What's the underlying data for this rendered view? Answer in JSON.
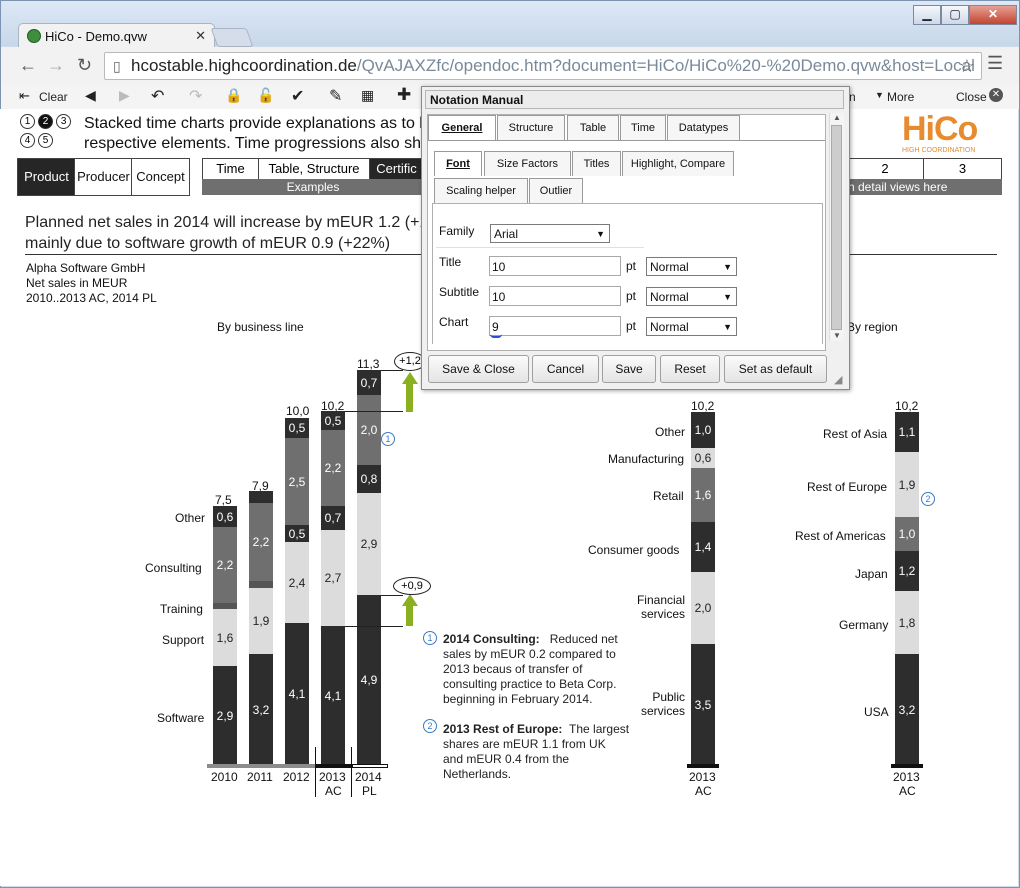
{
  "browser": {
    "tab_title": "HiCo - Demo.qvw",
    "url_host": "hcostable.highcoordination.de",
    "url_path": "/QvAJAXZfc/opendoc.htm?document=HiCo/HiCo%20-%20Demo.qvw&host=Local"
  },
  "qvtoolbar": {
    "clear": "Clear",
    "more": "More",
    "close": "Close",
    "partial_on": "n"
  },
  "header": {
    "step_circles": [
      "1",
      "2",
      "3",
      "4",
      "5"
    ],
    "line1": "Stacked time charts provide explanations as to ho",
    "line2": "respective elements. Time progressions also sho",
    "logo_text": "HiCo",
    "logo_sub": "HIGH COORDINATION"
  },
  "nav": {
    "product": "Product",
    "producer": "Producer",
    "concept": "Concept",
    "time": "Time",
    "table_structure": "Table, Structure",
    "certific": "Certific",
    "examples": "Examples",
    "right_nums": [
      "2",
      "3"
    ],
    "right_caption": "h detail views here"
  },
  "statement": {
    "line1": "Planned net sales in 2014 will increase by mEUR 1.2 (+12",
    "line2": "mainly due to software growth of mEUR 0.9 (+22%)"
  },
  "meta": {
    "company": "Alpha Software GmbH",
    "measure": "Net sales in MEUR",
    "period": "2010..2013 AC, 2014 PL"
  },
  "charts": {
    "by_business_line": "By business line",
    "by_region": "By region",
    "categories": [
      "Software",
      "Support",
      "Training",
      "Consulting",
      "Other"
    ],
    "years": [
      "2010",
      "2011",
      "2012",
      "2013",
      "2014"
    ],
    "year_sub": [
      "AC",
      "PL"
    ],
    "totals": [
      "7,5",
      "7,9",
      "10,0",
      "10,2",
      "11,3"
    ],
    "bars": [
      {
        "year": "2010",
        "software": "2,9",
        "support": "1,6",
        "consulting": "2,2",
        "other": "0,6"
      },
      {
        "year": "2011",
        "software": "3,2",
        "support": "1,9",
        "consulting": "2,2",
        "other": ""
      },
      {
        "year": "2012",
        "software": "4,1",
        "support": "2,4",
        "training": "0,5",
        "consulting": "2,5",
        "other": "0,5"
      },
      {
        "year": "2013",
        "software": "4,1",
        "support": "2,7",
        "training": "0,7",
        "consulting": "2,2",
        "other": "0,5"
      },
      {
        "year": "2014",
        "software": "4,9",
        "support": "2,9",
        "training": "0,8",
        "consulting": "2,0",
        "other": "0,7"
      }
    ],
    "delta_total": "+1,2",
    "delta_software": "+0,9",
    "industry": {
      "total": "10,2",
      "segments": [
        {
          "label": "Other",
          "value": "1,0"
        },
        {
          "label": "Manufacturing",
          "value": "0,6"
        },
        {
          "label": "Retail",
          "value": "1,6"
        },
        {
          "label": "Consumer goods",
          "value": "1,4"
        },
        {
          "label": "Financial services",
          "value": "2,0"
        },
        {
          "label": "Public services",
          "value": "3,5"
        }
      ],
      "x": "2013",
      "x_sub": "AC"
    },
    "region": {
      "total": "10,2",
      "segments": [
        {
          "label": "Rest of Asia",
          "value": "1,1"
        },
        {
          "label": "Rest of Europe",
          "value": "1,9"
        },
        {
          "label": "Rest of Americas",
          "value": "1,0"
        },
        {
          "label": "Japan",
          "value": "1,2"
        },
        {
          "label": "Germany",
          "value": "1,8"
        },
        {
          "label": "USA",
          "value": "3,2"
        }
      ],
      "x": "2013",
      "x_sub": "AC"
    }
  },
  "comments": [
    {
      "num": "1",
      "title": "2014 Consulting:",
      "lines": [
        "Reduced net",
        "sales by mEUR 0.2 compared to",
        "2013 becaus of transfer of",
        "consulting practice to Beta Corp.",
        "beginning in  February 2014."
      ]
    },
    {
      "num": "2",
      "title": "2013 Rest of Europe:",
      "lines": [
        "The largest",
        "shares are mEUR 1.1 from UK",
        "and mEUR 0.4 from the",
        "Netherlands."
      ]
    }
  ],
  "dialog": {
    "title": "Notation Manual",
    "tabs": [
      "General",
      "Structure",
      "Table",
      "Time",
      "Datatypes"
    ],
    "subtabs_row1": [
      "Font",
      "Size Factors",
      "Titles",
      "Highlight, Compare"
    ],
    "subtabs_row2": [
      "Scaling helper",
      "Outlier"
    ],
    "family_label": "Family",
    "family_value": "Arial",
    "rows": [
      {
        "label": "Title",
        "value": "10",
        "unit": "pt",
        "style": "Normal"
      },
      {
        "label": "Subtitle",
        "value": "10",
        "unit": "pt",
        "style": "Normal"
      },
      {
        "label": "Chart",
        "value": "9",
        "unit": "pt",
        "style": "Normal"
      }
    ],
    "buttons": [
      "Save & Close",
      "Cancel",
      "Save",
      "Reset",
      "Set as default"
    ]
  }
}
